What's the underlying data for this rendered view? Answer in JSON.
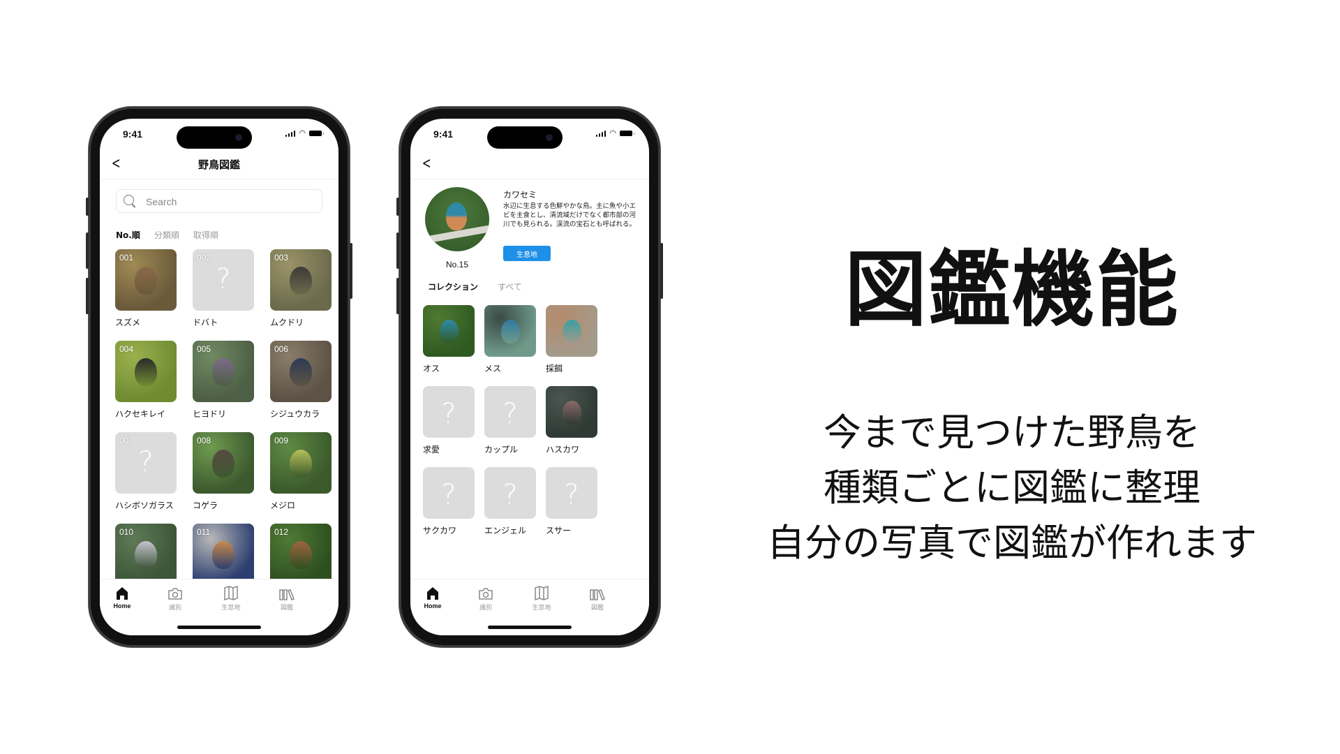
{
  "headline": "図鑑機能",
  "subtitle_lines": [
    "今まで見つけた野鳥を",
    "種類ごとに図鑑に整理",
    "自分の写真で図鑑が作れます"
  ],
  "status_bar": {
    "time": "9:41"
  },
  "tabbar": {
    "items": [
      {
        "label": "Home",
        "icon": "home-icon",
        "active": true
      },
      {
        "label": "識別",
        "icon": "camera-icon",
        "active": false
      },
      {
        "label": "生息地",
        "icon": "map-icon",
        "active": false
      },
      {
        "label": "図鑑",
        "icon": "books-icon",
        "active": false
      }
    ]
  },
  "list_screen": {
    "title": "野鳥図鑑",
    "back_icon": "chevron-left-icon",
    "search": {
      "placeholder": "Search",
      "value": ""
    },
    "sort_tabs": [
      {
        "label": "No.順",
        "active": true
      },
      {
        "label": "分類順",
        "active": false
      },
      {
        "label": "取得順",
        "active": false
      }
    ],
    "birds": [
      {
        "no": "001",
        "name": "スズメ",
        "found": true,
        "colors": [
          "#a08a55",
          "#6b5a3a",
          "#8a6a4a"
        ]
      },
      {
        "no": "002",
        "name": "ドバト",
        "found": false
      },
      {
        "no": "003",
        "name": "ムクドリ",
        "found": true,
        "colors": [
          "#9a9468",
          "#6b6a4c",
          "#3e3a36"
        ]
      },
      {
        "no": "004",
        "name": "ハクセキレイ",
        "found": true,
        "colors": [
          "#9bb04e",
          "#6f8c32",
          "#2b2b2b"
        ]
      },
      {
        "no": "005",
        "name": "ヒヨドリ",
        "found": true,
        "colors": [
          "#6f8a62",
          "#4d5f45",
          "#7c6a8a"
        ]
      },
      {
        "no": "006",
        "name": "シジュウカラ",
        "found": true,
        "colors": [
          "#8a7d6a",
          "#5c5346",
          "#2d3a55"
        ]
      },
      {
        "no": "007",
        "name": "ハシボソガラス",
        "found": false
      },
      {
        "no": "008",
        "name": "コゲラ",
        "found": true,
        "colors": [
          "#6f9a4f",
          "#3c5a2e",
          "#5a4a44"
        ]
      },
      {
        "no": "009",
        "name": "メジロ",
        "found": true,
        "colors": [
          "#5f8a45",
          "#3b5a2c",
          "#b5bf5a"
        ]
      },
      {
        "no": "010",
        "name": "",
        "found": true,
        "colors": [
          "#5d7a55",
          "#3d5538",
          "#c7c3cf"
        ]
      },
      {
        "no": "011",
        "name": "",
        "found": true,
        "colors": [
          "#b8b8b8",
          "#2d3f70",
          "#c98a4a"
        ]
      },
      {
        "no": "012",
        "name": "",
        "found": true,
        "colors": [
          "#4f7a35",
          "#2e5020",
          "#a0643e"
        ]
      }
    ]
  },
  "detail_screen": {
    "back_icon": "chevron-left-icon",
    "species_name": "カワセミ",
    "number": "No.15",
    "description": "水辺に生息する色鮮やかな鳥。主に魚や小エビを主食とし、清流域だけでなく都市部の河川でも見られる。渓流の宝石とも呼ばれる。",
    "habitat_button": "生息地",
    "accent_color": "#1e90e8",
    "collection_tabs": [
      {
        "label": "コレクション",
        "active": true
      },
      {
        "label": "すべて",
        "active": false
      }
    ],
    "variants": [
      {
        "name": "オス",
        "found": true,
        "colors": [
          "#4f7a32",
          "#2f5a22",
          "#2f8aa8"
        ]
      },
      {
        "name": "メス",
        "found": true,
        "colors": [
          "#3a4a45",
          "#6f9a8a",
          "#2f7aa0"
        ]
      },
      {
        "name": "採餌",
        "found": true,
        "colors": [
          "#b58a6a",
          "#a49a8a",
          "#3aa0a0"
        ]
      },
      {
        "name": "求愛",
        "found": false
      },
      {
        "name": "カップル",
        "found": false
      },
      {
        "name": "ハスカワ",
        "found": true,
        "colors": [
          "#4a5550",
          "#2f3a35",
          "#8a6a6a"
        ]
      },
      {
        "name": "サクカワ",
        "found": false
      },
      {
        "name": "エンジェル",
        "found": false
      },
      {
        "name": "スサー",
        "found": false
      }
    ]
  }
}
